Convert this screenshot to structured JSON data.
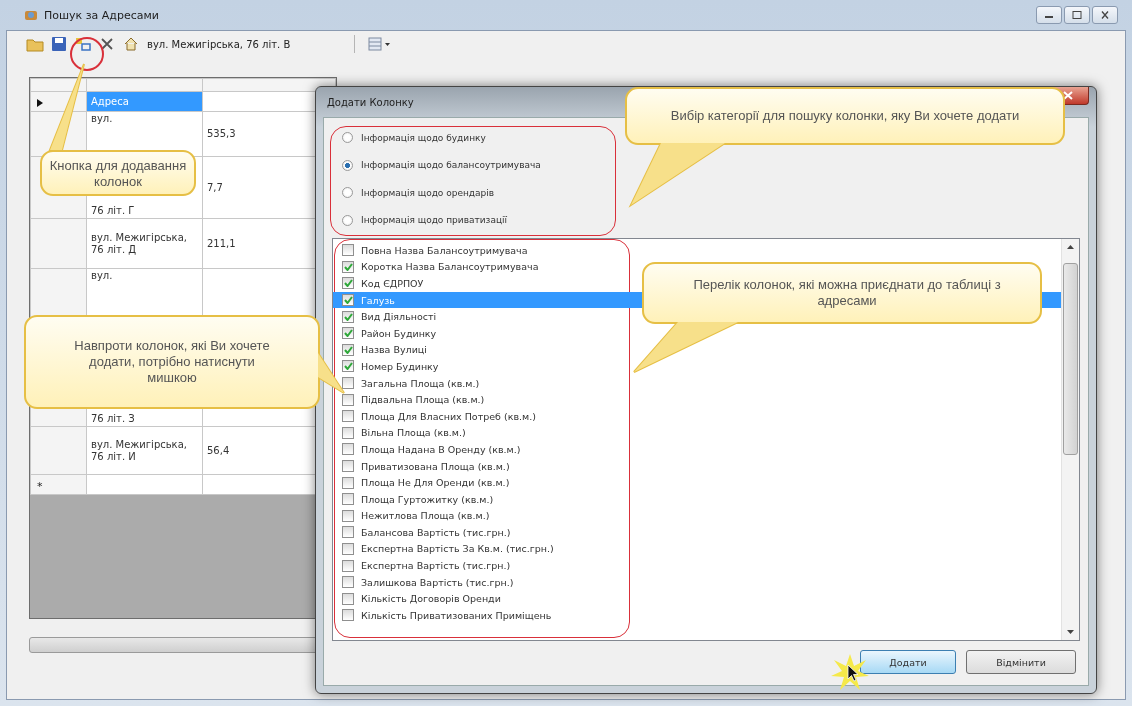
{
  "window": {
    "title": "Пошук за Адресами"
  },
  "toolbar": {
    "address": "вул. Межигірська, 76 літ. В"
  },
  "grid": {
    "rows": [
      {
        "address": "Адреса",
        "selected": true
      },
      {
        "address": "вул.",
        "value": "535,3",
        "selected": false
      },
      {
        "address": "76 літ. Г",
        "value": "7,7",
        "selected": false
      },
      {
        "address": "вул. Межигірська, 76 літ. Д",
        "value": "211,1",
        "selected": false
      },
      {
        "address": "вул.",
        "selected": false
      },
      {
        "address": "76 літ. З",
        "selected": false
      },
      {
        "address": "вул. Межигірська, 76 літ. И",
        "value": "56,4",
        "selected": false
      }
    ],
    "new_row_marker": "*"
  },
  "dialog": {
    "title": "Додати Колонку",
    "categories": [
      {
        "label": "Інформація щодо будинку",
        "selected": false
      },
      {
        "label": "Інформація щодо балансоутримувача",
        "selected": true
      },
      {
        "label": "Інформація щодо орендарів",
        "selected": false
      },
      {
        "label": "Інформація щодо приватизації",
        "selected": false
      }
    ],
    "columns": [
      {
        "label": "Повна Назва Балансоутримувача",
        "checked": false,
        "selected": false
      },
      {
        "label": "Коротка Назва Балансоутримувача",
        "checked": true,
        "selected": false
      },
      {
        "label": "Код ЄДРПОУ",
        "checked": true,
        "selected": false
      },
      {
        "label": "Галузь",
        "checked": true,
        "selected": true
      },
      {
        "label": "Вид Діяльності",
        "checked": true,
        "selected": false
      },
      {
        "label": "Район Будинку",
        "checked": true,
        "selected": false
      },
      {
        "label": "Назва Вулиці",
        "checked": true,
        "selected": false
      },
      {
        "label": "Номер Будинку",
        "checked": true,
        "selected": false
      },
      {
        "label": "Загальна Площа (кв.м.)",
        "checked": false,
        "selected": false
      },
      {
        "label": "Підвальна Площа (кв.м.)",
        "checked": false,
        "selected": false
      },
      {
        "label": "Площа Для Власних Потреб (кв.м.)",
        "checked": false,
        "selected": false
      },
      {
        "label": "Вільна Площа (кв.м.)",
        "checked": false,
        "selected": false
      },
      {
        "label": "Площа Надана В Оренду (кв.м.)",
        "checked": false,
        "selected": false
      },
      {
        "label": "Приватизована Площа (кв.м.)",
        "checked": false,
        "selected": false
      },
      {
        "label": "Площа Не Для Оренди (кв.м.)",
        "checked": false,
        "selected": false
      },
      {
        "label": "Площа Гуртожитку (кв.м.)",
        "checked": false,
        "selected": false
      },
      {
        "label": "Нежитлова Площа (кв.м.)",
        "checked": false,
        "selected": false
      },
      {
        "label": "Балансова Вартість (тис.грн.)",
        "checked": false,
        "selected": false
      },
      {
        "label": "Експертна Вартість За Кв.м. (тис.грн.)",
        "checked": false,
        "selected": false
      },
      {
        "label": "Експертна Вартість (тис.грн.)",
        "checked": false,
        "selected": false
      },
      {
        "label": "Залишкова Вартість (тис.грн.)",
        "checked": false,
        "selected": false
      },
      {
        "label": "Кількість Договорів Оренди",
        "checked": false,
        "selected": false
      },
      {
        "label": "Кількість Приватизованих Приміщень",
        "checked": false,
        "selected": false
      }
    ],
    "buttons": [
      {
        "label": "Додати",
        "focused": true
      },
      {
        "label": "Відмінити",
        "focused": false
      }
    ]
  },
  "callouts": [
    {
      "text": "Кнопка для додавання колонок"
    },
    {
      "text": "Навпроти колонок, які Ви хочете додати, потрібно натиснути мишкою"
    },
    {
      "text": "Вибір категорії для пошуку колонки, яку Ви хочете додати"
    },
    {
      "text": "Перелік колонок, які можна приєднати до таблиці з адресами"
    }
  ]
}
